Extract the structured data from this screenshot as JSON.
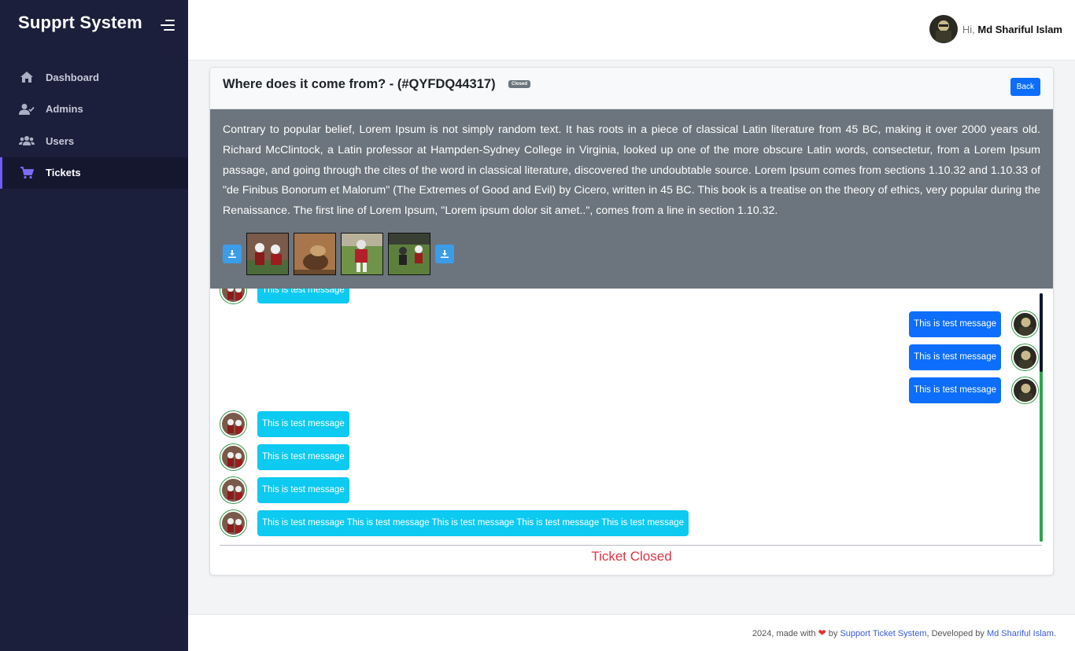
{
  "app": {
    "brand": "Supprt System"
  },
  "sidebar": {
    "items": [
      {
        "label": "Dashboard",
        "icon": "home-icon"
      },
      {
        "label": "Admins",
        "icon": "user-check-icon"
      },
      {
        "label": "Users",
        "icon": "users-icon"
      },
      {
        "label": "Tickets",
        "icon": "cart-icon",
        "active": true
      }
    ]
  },
  "header": {
    "greeting": "Hi,",
    "user_name": "Md Shariful Islam"
  },
  "ticket": {
    "title": "Where does it come from? - (#QYFDQ44317)",
    "status_badge": "Closed",
    "back_label": "Back",
    "description": "Contrary to popular belief, Lorem Ipsum is not simply random text. It has roots in a piece of classical Latin literature from 45 BC, making it over 2000 years old. Richard McClintock, a Latin professor at Hampden-Sydney College in Virginia, looked up one of the more obscure Latin words, consectetur, from a Lorem Ipsum passage, and going through the cites of the word in classical literature, discovered the undoubtable source. Lorem Ipsum comes from sections 1.10.32 and 1.10.33 of \"de Finibus Bonorum et Malorum\" (The Extremes of Good and Evil) by Cicero, written in 45 BC. This book is a treatise on the theory of ethics, very popular during the Renaissance. The first line of Lorem Ipsum, \"Lorem ipsum dolor sit amet..\", comes from a line in section 1.10.32.",
    "closed_text": "Ticket Closed"
  },
  "messages": [
    {
      "side": "left",
      "text": "This is test message"
    },
    {
      "side": "right",
      "text": "This is test message"
    },
    {
      "side": "right",
      "text": "This is test message"
    },
    {
      "side": "right",
      "text": "This is test message"
    },
    {
      "side": "left",
      "text": "This is test message"
    },
    {
      "side": "left",
      "text": "This is test message"
    },
    {
      "side": "left",
      "text": "This is test message"
    },
    {
      "side": "left",
      "text": "This is test message This is test message This is test message This is test message This is test message"
    }
  ],
  "footer": {
    "prefix": "2024, made with",
    "by": "by",
    "system_link": "Support Ticket System",
    "developed_by": ", Developed by",
    "author_link": "Md Shariful Islam",
    "suffix": "."
  },
  "colors": {
    "sidebar_bg": "#1b1f3b",
    "primary": "#0d6efd",
    "info": "#0dcaf0",
    "danger": "#dc3545",
    "secondary": "#6c757d"
  }
}
